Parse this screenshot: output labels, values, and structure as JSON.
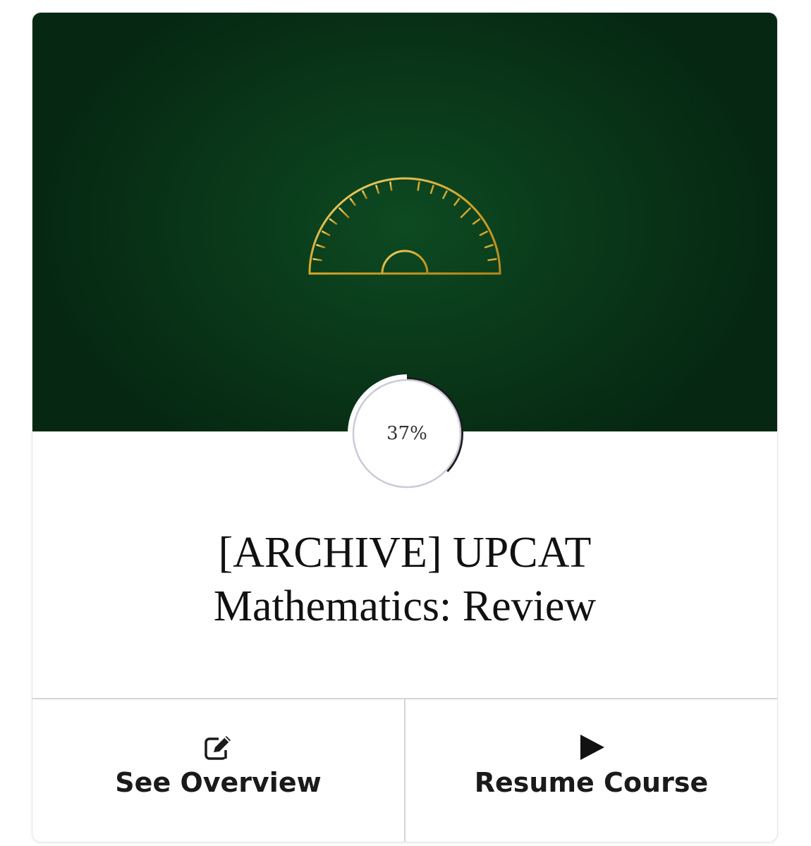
{
  "course": {
    "title_line1": "[ARCHIVE] UPCAT",
    "title_line2": "Mathematics: Review",
    "progress_text": "37%",
    "progress_value": 0.37
  },
  "actions": {
    "overview_label": "See Overview",
    "resume_label": "Resume Course"
  },
  "icons": {
    "hero": "protractor-icon",
    "overview": "edit-icon",
    "resume": "play-icon"
  },
  "colors": {
    "hero_bg": "#0a3a1a",
    "accent_gold": "#d9b23a",
    "progress_arc": "#222222"
  }
}
